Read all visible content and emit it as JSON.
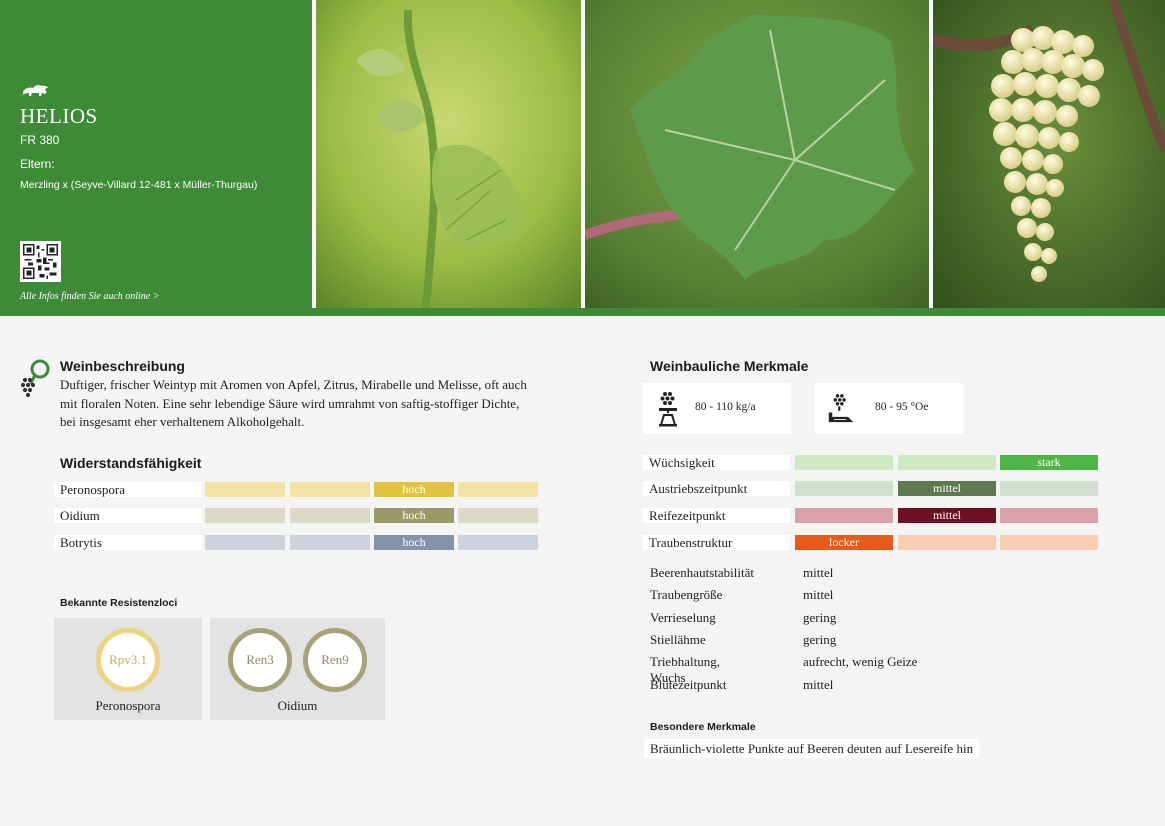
{
  "header": {
    "variety_name": "HELIOS",
    "variety_code": "FR 380",
    "parents_label": "Eltern:",
    "parents_value": "Merzling x (Seyve-Villard 12-481 x Müller-Thurgau)",
    "online_link": "Alle Infos finden Sie auch online >",
    "brand_color": "#3d8a37"
  },
  "wine_description": {
    "heading": "Weinbeschreibung",
    "text": "Duftiger, frischer Weintyp mit Aromen von Apfel, Zitrus, Mirabelle und Melisse, oft auch mit floralen Noten. Eine sehr lebendige Säure wird umrahmt von saftig-stoffiger Dichte, bei insgesamt eher verhaltenem Alkoholgehalt."
  },
  "resistance": {
    "heading": "Widerstandsfähigkeit",
    "rows": [
      {
        "label": "Peronospora",
        "level_index": 2,
        "level_label": "hoch",
        "light_color": "#f2e3a3",
        "dark_color": "#e2c33f"
      },
      {
        "label": "Oidium",
        "level_index": 2,
        "level_label": "hoch",
        "light_color": "#dcdac6",
        "dark_color": "#9b9a66"
      },
      {
        "label": "Botrytis",
        "level_index": 2,
        "level_label": "hoch",
        "light_color": "#ccd3df",
        "dark_color": "#8494a8"
      }
    ]
  },
  "resistance_loci": {
    "heading": "Bekannte Resistenzloci",
    "groups": [
      {
        "label": "Peronospora",
        "loci": [
          "Rpv3.1"
        ],
        "ring_color": "#ecd47c",
        "text_color": "#c9ad4c"
      },
      {
        "label": "Oidium",
        "loci": [
          "Ren3",
          "Ren9"
        ],
        "ring_color": "#a6a379",
        "text_color": "#8f8c5d"
      }
    ]
  },
  "viticulture": {
    "heading": "Weinbauliche Merkmale",
    "yield": {
      "value": "80 - 110 kg/a",
      "icon": "grape-scale-icon"
    },
    "must_weight": {
      "value": "80 - 95 °Oe",
      "icon": "grape-refractometer-icon"
    },
    "rows": [
      {
        "label": "Wüchsigkeit",
        "level_index": 2,
        "level_label": "stark",
        "light_color": "#cfe9c4",
        "dark_color": "#4fb546"
      },
      {
        "label": "Austriebszeitpunkt",
        "level_index": 1,
        "level_label": "mittel",
        "light_color": "#d2dfd0",
        "dark_color": "#5d7a4f"
      },
      {
        "label": "Reifezeitpunkt",
        "level_index": 1,
        "level_label": "mittel",
        "light_color": "#d9a1aa",
        "dark_color": "#6e0f24"
      },
      {
        "label": "Traubenstruktur",
        "level_index": 0,
        "level_label": "locker",
        "light_color": "#f8cdb2",
        "dark_color": "#e75a17"
      }
    ],
    "properties": [
      {
        "label": "Beerenhautstabilität",
        "value": "mittel"
      },
      {
        "label": "Traubengröße",
        "value": "mittel"
      },
      {
        "label": "Verrieselung",
        "value": "gering"
      },
      {
        "label": "Stiellähme",
        "value": "gering"
      },
      {
        "label": "Triebhaltung, Wuchs",
        "value": "aufrecht, wenig Geize"
      },
      {
        "label": "Blütezeitpunkt",
        "value": "mittel"
      }
    ]
  },
  "special": {
    "heading": "Besondere Merkmale",
    "text": "Bräunlich-violette Punkte auf Beeren deuten auf Lesereife hin"
  },
  "icons": {
    "lion": "lion-logo-icon",
    "qr": "qr-code-icon",
    "description": "magnifier-grape-icon"
  }
}
